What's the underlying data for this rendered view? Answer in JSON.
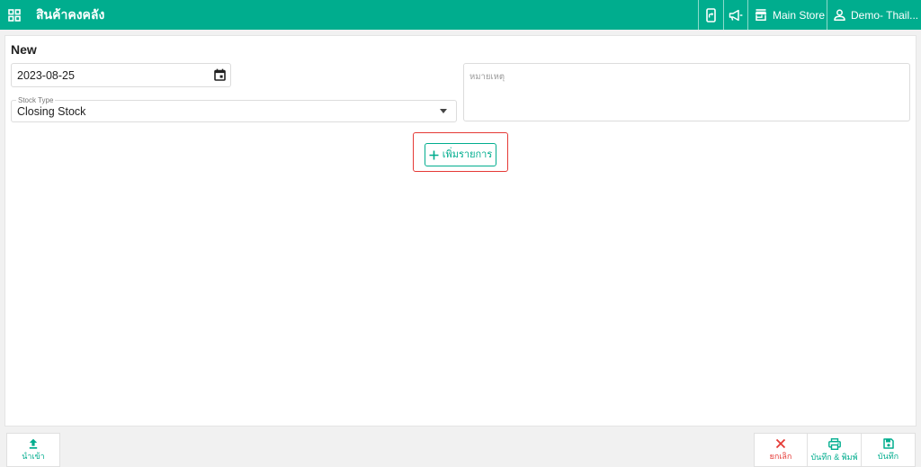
{
  "theme": {
    "accent": "#00AD8E",
    "danger": "#E53935",
    "highlight": "#E53935"
  },
  "header": {
    "title": "สินค้าคงคลัง",
    "store_name": "Main Store",
    "user_name": "Demo- Thail..."
  },
  "form": {
    "heading": "New",
    "date": {
      "value": "2023-08-25"
    },
    "stock_type": {
      "label": "Stock Type",
      "value": "Closing Stock"
    },
    "notes": {
      "placeholder": "หมายเหตุ"
    },
    "add_item_label": "เพิ่มรายการ"
  },
  "footer": {
    "import_label": "นำเข้า",
    "cancel_label": "ยกเลิก",
    "save_print_label": "บันทึก & พิมพ์",
    "save_label": "บันทึก"
  },
  "icons": {
    "apps_menu": "grid-icon",
    "mobile_share": "phone-arrow-icon",
    "announcements": "megaphone-icon",
    "store": "store-icon",
    "user": "user-icon",
    "date_picker": "calendar-icon",
    "stock_type_dropdown": "caret-down-icon",
    "add_item": "plus-icon",
    "import": "upload-icon",
    "cancel": "close-icon",
    "save_print": "printer-icon",
    "save": "save-icon"
  }
}
